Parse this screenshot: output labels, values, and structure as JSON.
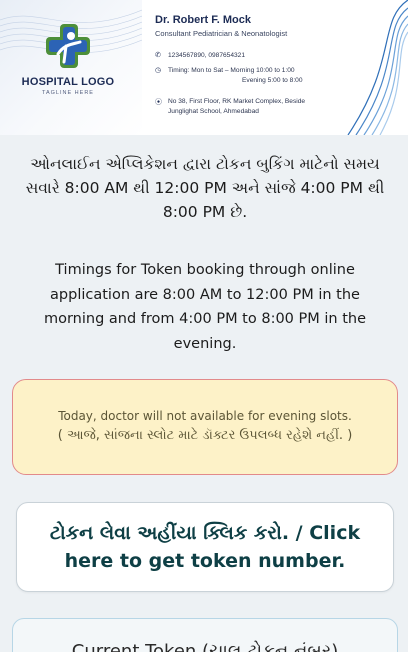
{
  "header": {
    "logo_title": "HOSPITAL LOGO",
    "logo_tagline": "TAGLINE HERE",
    "doctor_name": "Dr. Robert F. Mock",
    "doctor_title": "Consultant Pediatrician & Neonatologist",
    "phone": "1234567890, 0987654321",
    "timing_line1": "Timing: Mon to Sat – Morning 10:00 to 1:00",
    "timing_line2": "Evening 5:00 to 8:00",
    "address_line1": "No 38, First Floor, RK Market Complex, Beside",
    "address_line2": "Junglighat School, Ahmedabad"
  },
  "notice": {
    "gujarati": "ઓનલાઈન એપ્લિકેશન દ્વારા ટોકન બુકિંગ માટેનો સમય સવારે 8:00 AM થી 12:00 PM અને સાંજે 4:00 PM થી 8:00 PM છે.",
    "english": "Timings for Token booking through online application are 8:00 AM to 12:00 PM in the morning and from 4:00 PM to 8:00 PM in the evening."
  },
  "alert": {
    "english": "Today, doctor will not available for evening slots.",
    "gujarati": "( આજે, સાંજના સ્લોટ માટે ડૉક્ટર ઉપલબ્ધ રહેશે નહીં. )"
  },
  "token_button": {
    "label": "ટોકન લેવા અહીંયા ક્લિક કરો. / Click here to get token number."
  },
  "current_token": {
    "label": "Current Token (ચાલુ ટોકન નંબર)"
  },
  "colors": {
    "page_bg": "#edf1f4",
    "alert_bg": "#fdf2c8",
    "alert_border": "#e28a8a",
    "button_text": "#0e3f45",
    "brand_navy": "#1d2c55"
  }
}
